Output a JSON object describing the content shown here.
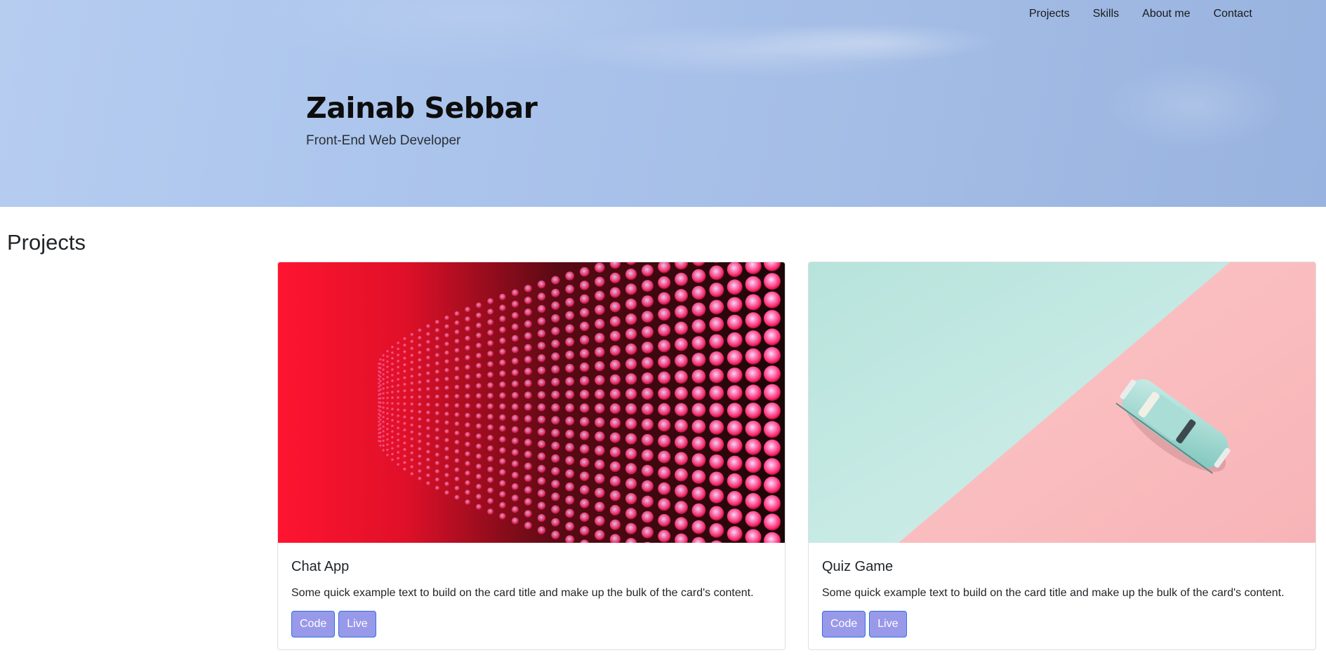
{
  "nav": {
    "items": [
      "Projects",
      "Skills",
      "About me",
      "Contact"
    ]
  },
  "hero": {
    "name": "Zainab Sebbar",
    "role": "Front-End Web Developer"
  },
  "projects": {
    "heading": "Projects",
    "cards": [
      {
        "title": "Chat App",
        "text": "Some quick example text to build on the card title and make up the bulk of the card's content.",
        "image": "led-wall-image",
        "code_label": "Code",
        "live_label": "Live"
      },
      {
        "title": "Quiz Game",
        "text": "Some quick example text to build on the card title and make up the bulk of the card's content.",
        "image": "toy-car-image",
        "code_label": "Code",
        "live_label": "Live"
      }
    ]
  },
  "colors": {
    "hero_sky": "#a9c2ea",
    "button_bg": "#9999ea",
    "button_border": "#2f6ee8",
    "text": "#212529"
  }
}
